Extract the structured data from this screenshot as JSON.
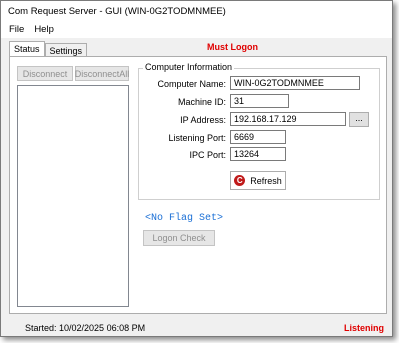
{
  "window": {
    "title": "Com Request Server - GUI  (WIN-0G2TODMNMEE)"
  },
  "menu": [
    "File",
    "Help"
  ],
  "tabs": [
    {
      "label": "Status",
      "active": true
    },
    {
      "label": "Settings",
      "active": false
    }
  ],
  "alert": {
    "text": "Must Logon",
    "color": "#e00000"
  },
  "buttons": {
    "disconnect": "Disconnect",
    "disconnect_all": "DisconnectAll",
    "browse": "...",
    "refresh": "Refresh",
    "logon_check": "Logon Check"
  },
  "computer_info": {
    "legend": "Computer Information",
    "fields": [
      {
        "label": "Computer Name:",
        "value": "WIN-0G2TODMNMEE"
      },
      {
        "label": "Machine ID:",
        "value": "31"
      },
      {
        "label": "IP Address:",
        "value": "192.168.17.129"
      },
      {
        "label": "Listening Port:",
        "value": "6669"
      },
      {
        "label": "IPC Port:",
        "value": "13264"
      }
    ]
  },
  "flag": {
    "text": "<No Flag Set>",
    "color": "#1a6fd6"
  },
  "status": {
    "started": "Started: 10/02/2025 06:08 PM",
    "state": "Listening",
    "state_color": "#e00000"
  },
  "icons": {
    "refresh": "refresh-icon"
  }
}
